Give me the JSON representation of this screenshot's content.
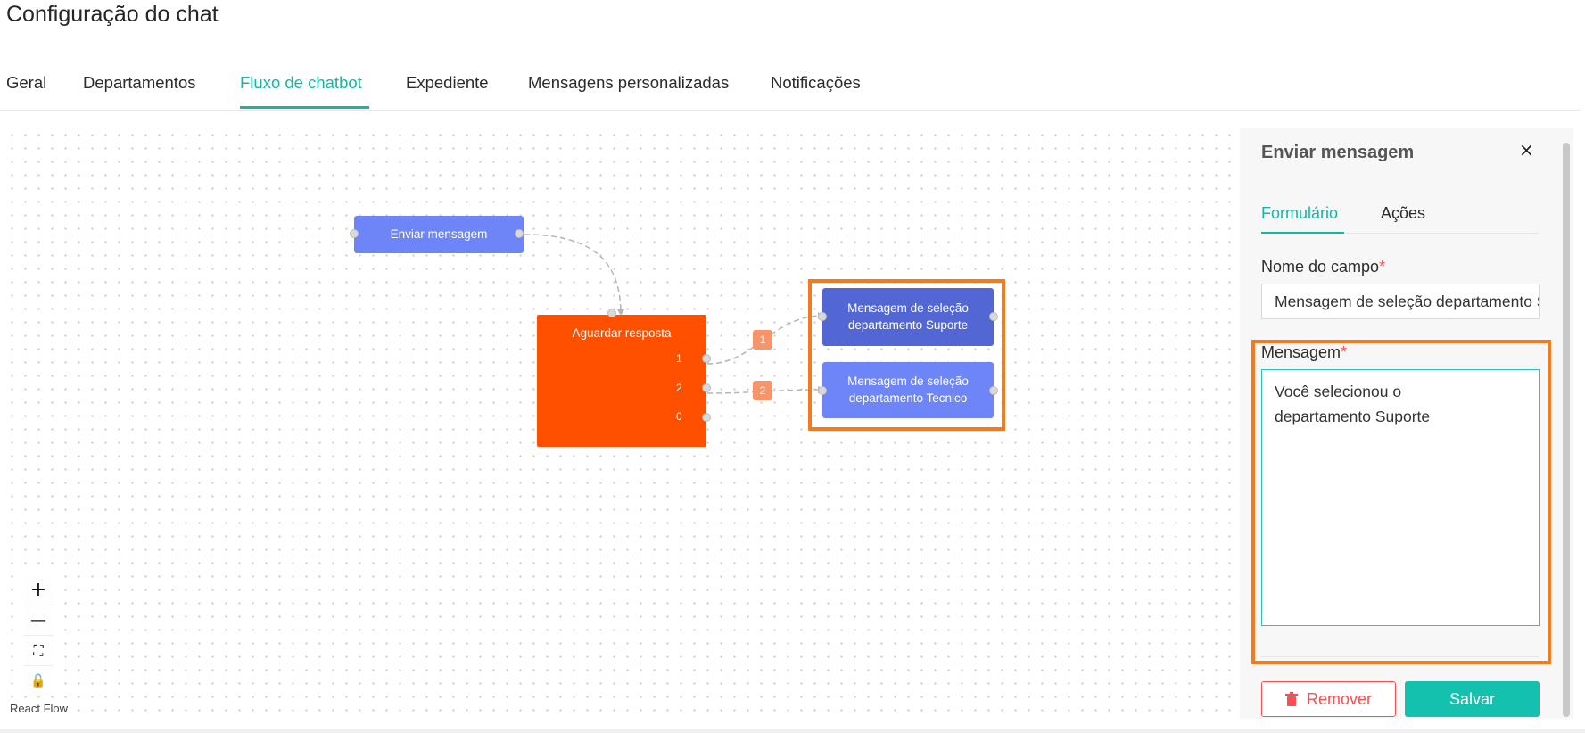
{
  "page": {
    "title": "Configuração do chat"
  },
  "tabs": [
    {
      "label": "Geral"
    },
    {
      "label": "Departamentos"
    },
    {
      "label": "Fluxo de chatbot",
      "active": true
    },
    {
      "label": "Expediente"
    },
    {
      "label": "Mensagens personalizadas"
    },
    {
      "label": "Notificações"
    }
  ],
  "flow": {
    "nodes": {
      "send": "Enviar mensagem",
      "wait": "Aguardar resposta",
      "wait_ports": [
        "1",
        "2",
        "0"
      ],
      "support": "Mensagem de seleção departamento Suporte",
      "technical": "Mensagem de seleção departamento Tecnico"
    },
    "edge_labels": [
      "1",
      "2"
    ],
    "controls": {
      "zoom_in": "+",
      "zoom_out": "—",
      "fit": "⛶",
      "lock": "🔓"
    },
    "attribution": "React Flow"
  },
  "panel": {
    "title": "Enviar mensagem",
    "close": "×",
    "tabs": [
      {
        "label": "Formulário",
        "active": true
      },
      {
        "label": "Ações"
      }
    ],
    "field_name": {
      "label": "Nome do campo",
      "required_mark": "*",
      "value": "Mensagem de seleção departamento Suporte"
    },
    "message": {
      "label": "Mensagem",
      "required_mark": "*",
      "value": "Você selecionou o\ndepartamento Suporte"
    },
    "remove_label": "Remover",
    "save_label": "Salvar"
  },
  "colors": {
    "accent": "#16b6a6",
    "wait_node": "#ff5000",
    "message_node": "#6e85f7",
    "highlight": "#f47a20",
    "danger": "#ff4d4f"
  }
}
